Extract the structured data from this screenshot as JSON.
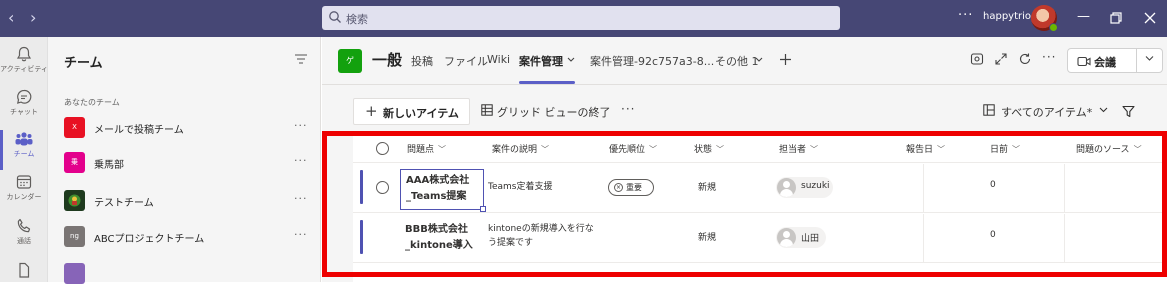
{
  "titlebar": {
    "search_placeholder": "検索",
    "username": "happytrio"
  },
  "rail": [
    {
      "label": "アクティビティ",
      "icon": "bell-icon"
    },
    {
      "label": "チャット",
      "icon": "chat-icon"
    },
    {
      "label": "チーム",
      "icon": "teams-icon",
      "active": true
    },
    {
      "label": "カレンダー",
      "icon": "calendar-icon"
    },
    {
      "label": "通話",
      "icon": "phone-icon"
    }
  ],
  "teams_panel": {
    "title": "チーム",
    "section": "あなたのチーム",
    "teams": [
      {
        "name": "メールで投稿チーム",
        "tile": "X",
        "color": "#e81123"
      },
      {
        "name": "乗馬部",
        "tile": "乗",
        "color": "#e3008c"
      },
      {
        "name": "テストチーム",
        "tile": "",
        "color": "#1e3a1e"
      },
      {
        "name": "ABCプロジェクトチーム",
        "tile": "ng",
        "color": "#7a7574"
      }
    ]
  },
  "channel": {
    "icon_text": "ゲ",
    "name": "一般",
    "tabs": [
      "投稿",
      "ファイル",
      "Wiki",
      "案件管理",
      "案件管理-92c757a3-8...",
      "その他 1"
    ],
    "active_tab": "案件管理",
    "meet_label": "会議"
  },
  "commandbar": {
    "new_item": "新しいアイテム",
    "grid_exit": "グリッド ビューの終了",
    "view": "すべてのアイテム*"
  },
  "list": {
    "columns": [
      "問題点",
      "案件の説明",
      "優先順位",
      "状態",
      "担当者",
      "報告日",
      "日前",
      "問題のソース"
    ],
    "rows": [
      {
        "title_line1": "AAA株式会社",
        "title_line2": "_Teams提案",
        "desc": "Teams定着支援",
        "priority": "重要",
        "status": "新規",
        "assignee": "suzuki",
        "days": "0"
      },
      {
        "title_line1": "BBB株式会社",
        "title_line2": "_kintone導入",
        "desc": "kintoneの新規導入を行なう提案です",
        "priority": "",
        "status": "新規",
        "assignee": "山田",
        "days": "0"
      }
    ]
  },
  "colors": {
    "titlebar": "#464775",
    "accent": "#5b5fc7",
    "highlight_box": "#ee0000"
  }
}
